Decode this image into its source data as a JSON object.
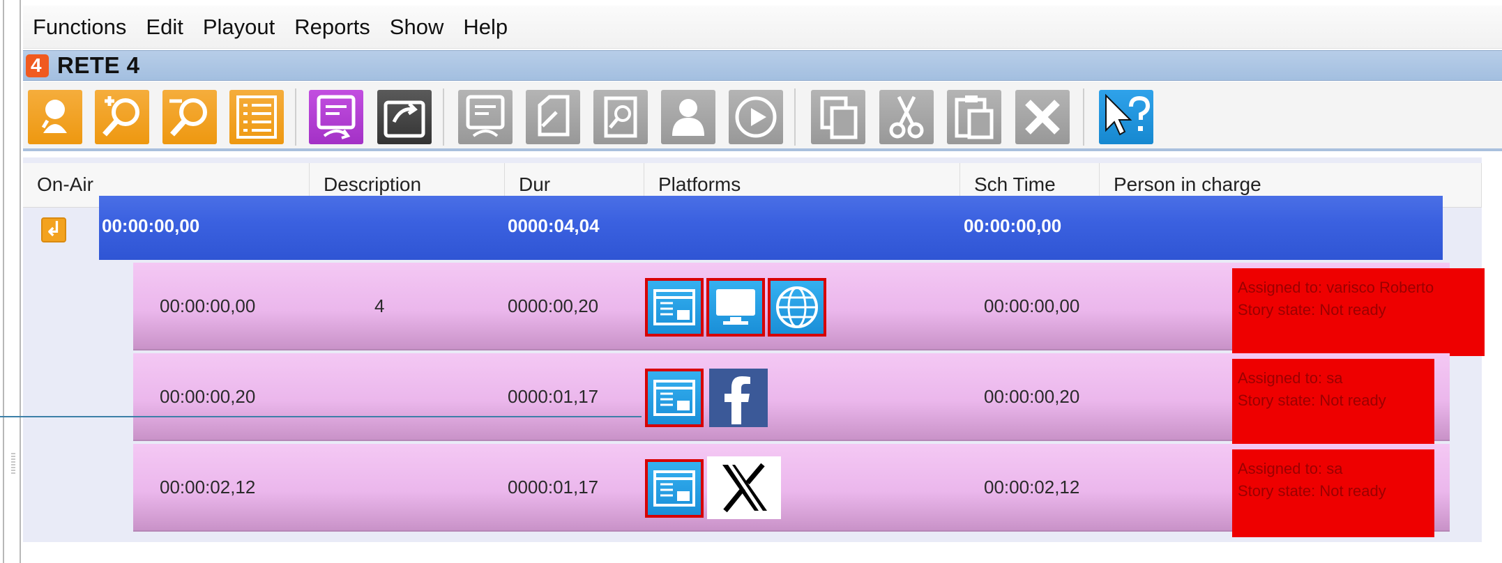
{
  "menu": [
    "Functions",
    "Edit",
    "Playout",
    "Reports",
    "Show",
    "Help"
  ],
  "window": {
    "title": "RETE 4"
  },
  "toolbar": {
    "buttons": [
      {
        "icon": "person-pin-icon",
        "color": "#EE9810"
      },
      {
        "icon": "zoom-in-icon",
        "color": "#EE9810"
      },
      {
        "icon": "zoom-out-icon",
        "color": "#EE9810"
      },
      {
        "icon": "list-icon",
        "color": "#EE9810"
      },
      {
        "icon": "transfer-purple-icon",
        "color": "#A331C6"
      },
      {
        "icon": "transfer-dark-icon",
        "color": "#333333"
      },
      {
        "icon": "transfer-gray-icon",
        "color": "#989898"
      },
      {
        "icon": "document-icon",
        "color": "#989898"
      },
      {
        "icon": "search-document-icon",
        "color": "#989898"
      },
      {
        "icon": "person-icon",
        "color": "#989898"
      },
      {
        "icon": "play-icon",
        "color": "#989898"
      },
      {
        "icon": "copy-icon",
        "color": "#989898"
      },
      {
        "icon": "cut-icon",
        "color": "#989898"
      },
      {
        "icon": "paste-icon",
        "color": "#989898"
      },
      {
        "icon": "delete-icon",
        "color": "#989898"
      },
      {
        "icon": "help-icon",
        "color": "#1688D0"
      }
    ]
  },
  "grid": {
    "columns": [
      "On-Air",
      "Description",
      "Dur",
      "Platforms",
      "Sch Time",
      "Person in charge"
    ],
    "group": {
      "on_air": "00:00:00,00",
      "dur": "0000:04,04",
      "sch_time": "00:00:00,00",
      "color": "#3B61E0"
    },
    "stories": [
      {
        "on_air": "00:00:00,00",
        "description": "4",
        "dur": "0000:00,20",
        "platforms": [
          "web-page-icon",
          "tv-monitor-icon",
          "www-globe-icon"
        ],
        "sch_time": "00:00:00,00",
        "assigned": "Assigned to: varisco Roberto",
        "state": "Story state: Not ready"
      },
      {
        "on_air": "00:00:00,20",
        "description": "",
        "dur": "0000:01,17",
        "platforms": [
          "web-page-icon",
          "facebook-icon"
        ],
        "sch_time": "00:00:00,20",
        "assigned": "Assigned to: sa",
        "state": "Story state: Not ready"
      },
      {
        "on_air": "00:00:02,12",
        "description": "",
        "dur": "0000:01,17",
        "platforms": [
          "web-page-icon",
          "x-logo-icon"
        ],
        "sch_time": "00:00:02,12",
        "assigned": "Assigned to: sa",
        "state": "Story state: Not ready"
      }
    ],
    "assign_color": "#EE0000",
    "story_color": "#EBB7EC"
  }
}
